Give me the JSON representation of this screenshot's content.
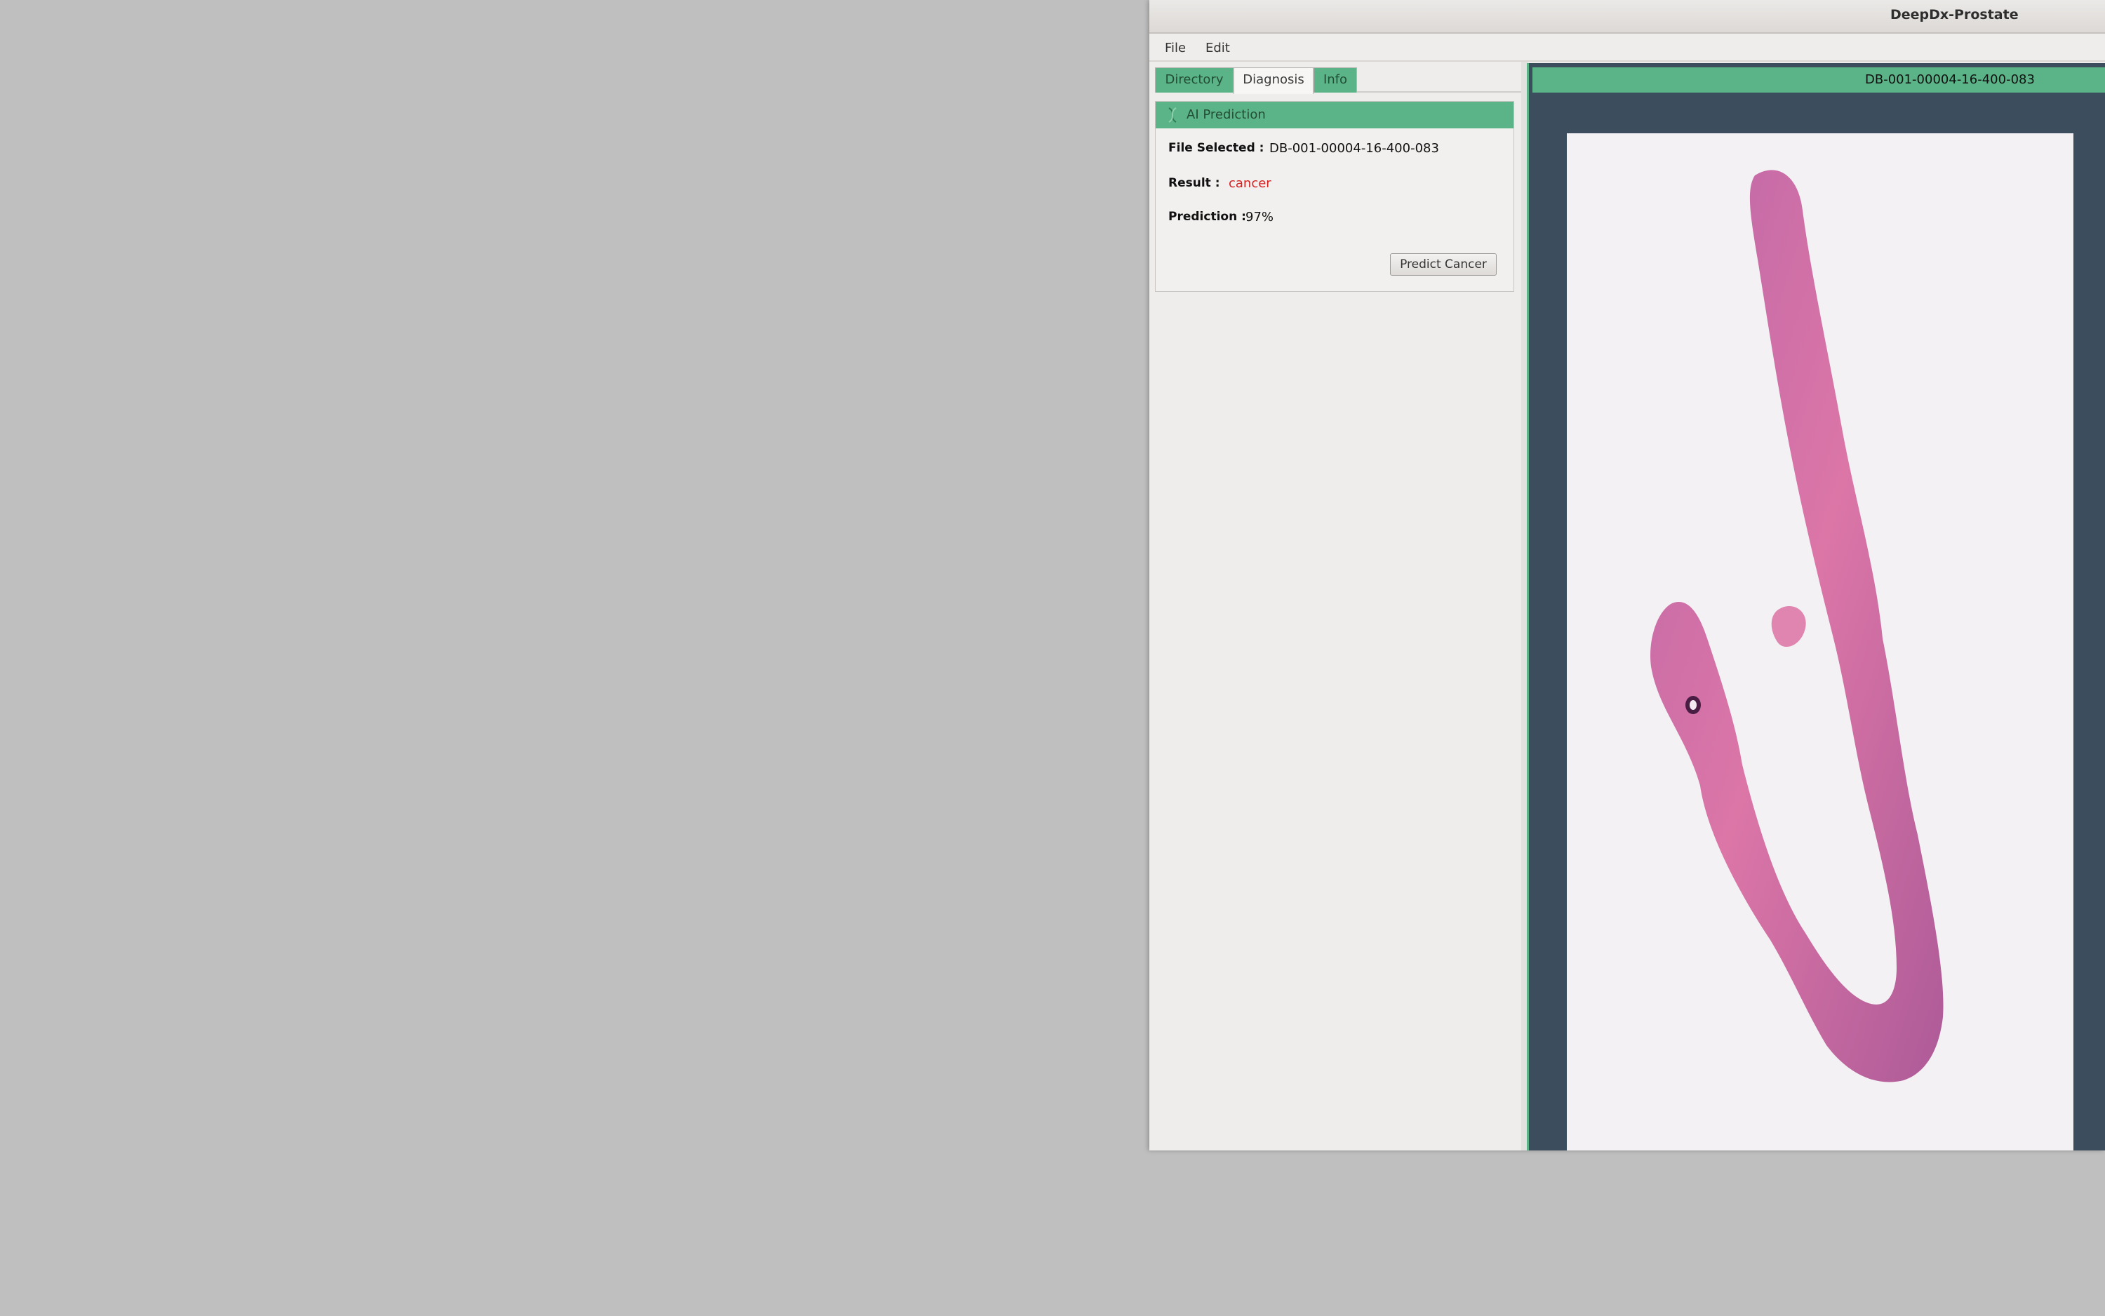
{
  "window": {
    "title": "DeepDx-Prostate"
  },
  "menu": {
    "file": "File",
    "edit": "Edit"
  },
  "tabs": [
    {
      "label": "Directory",
      "active": false
    },
    {
      "label": "Diagnosis",
      "active": true
    },
    {
      "label": "Info",
      "active": false
    }
  ],
  "ai_prediction": {
    "header": "AI Prediction",
    "file_selected_label": "File Selected  :",
    "file_selected_value": "DB-001-00004-16-400-083",
    "result_label": "Result  :",
    "result_value": "cancer",
    "prediction_label": "Prediction :",
    "prediction_value": "97%",
    "predict_button": "Predict Cancer"
  },
  "viewer": {
    "header": "DB-001-00004-16-400-083"
  },
  "colors": {
    "accent_green": "#5bb487",
    "viewer_bg": "#3c4e5e",
    "result_red": "#d62020"
  }
}
